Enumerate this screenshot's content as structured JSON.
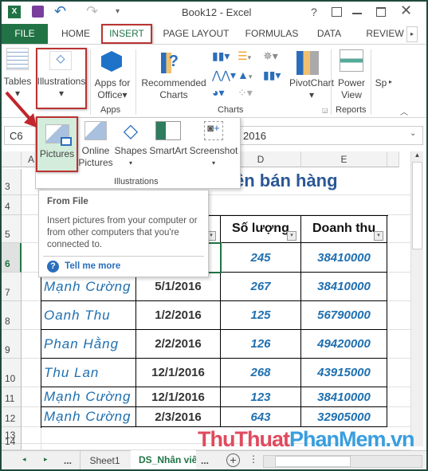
{
  "title_bar": {
    "title": "Book12 - Excel",
    "help": "?"
  },
  "tabs": [
    "FILE",
    "HOME",
    "INSERT",
    "PAGE LAYOUT",
    "FORMULAS",
    "DATA",
    "REVIEW"
  ],
  "active_tab": "INSERT",
  "ribbon": {
    "tables": "Tables",
    "illustrations": "Illustrations",
    "apps_for": "Apps for",
    "office": "Office",
    "apps_group": "Apps",
    "recommended": "Recommended",
    "charts_word": "Charts",
    "pivotchart": "PivotChart",
    "power": "Power",
    "view": "View",
    "charts_group": "Charts",
    "reports_group": "Reports",
    "sp": "Sp"
  },
  "dropdown": {
    "pictures": "Pictures",
    "online": "Online",
    "online2": "Pictures",
    "shapes": "Shapes",
    "smartart": "SmartArt",
    "screenshot": "Screenshot",
    "group": "Illustrations"
  },
  "tooltip": {
    "title": "From File",
    "body": "Insert pictures from your computer or from other computers that you're connected to.",
    "link": "Tell me more"
  },
  "formula_bar": {
    "name_box": "C6",
    "value": "2016"
  },
  "columns": [
    "A",
    "D",
    "E"
  ],
  "rows": [
    "3",
    "4",
    "5",
    "6",
    "7",
    "8",
    "9",
    "10",
    "11",
    "12",
    "13",
    "14"
  ],
  "sheet_title": "ên bán hàng",
  "headers": {
    "qty": "Số lượng",
    "revenue": "Doanh thu"
  },
  "table": [
    {
      "name": "",
      "date": "",
      "qty": "245",
      "rev": "38410000"
    },
    {
      "name": "Mạnh Cường",
      "date": "5/1/2016",
      "qty": "267",
      "rev": "38410000"
    },
    {
      "name": "Oanh Thu",
      "date": "1/2/2016",
      "qty": "125",
      "rev": "56790000"
    },
    {
      "name": "Phan Hằng",
      "date": "2/2/2016",
      "qty": "126",
      "rev": "49420000"
    },
    {
      "name": "Thu Lan",
      "date": "12/1/2016",
      "qty": "268",
      "rev": "43915000"
    },
    {
      "name": "Mạnh Cường",
      "date": "12/1/2016",
      "qty": "123",
      "rev": "38410000"
    },
    {
      "name": "Mạnh Cường",
      "date": "2/3/2016",
      "qty": "643",
      "rev": "32905000"
    }
  ],
  "sheet_tabs": {
    "ellipsis": "...",
    "sheet1": "Sheet1",
    "active": "DS_Nhân viê",
    "ellipsis2": "..."
  },
  "watermark": {
    "part1": "ThuThuat",
    "part2": "PhanMem",
    "part3": ".vn"
  },
  "colors": {
    "excel_green": "#217346",
    "highlight_red": "#b33333",
    "cell_blue": "#1f6fb0"
  }
}
